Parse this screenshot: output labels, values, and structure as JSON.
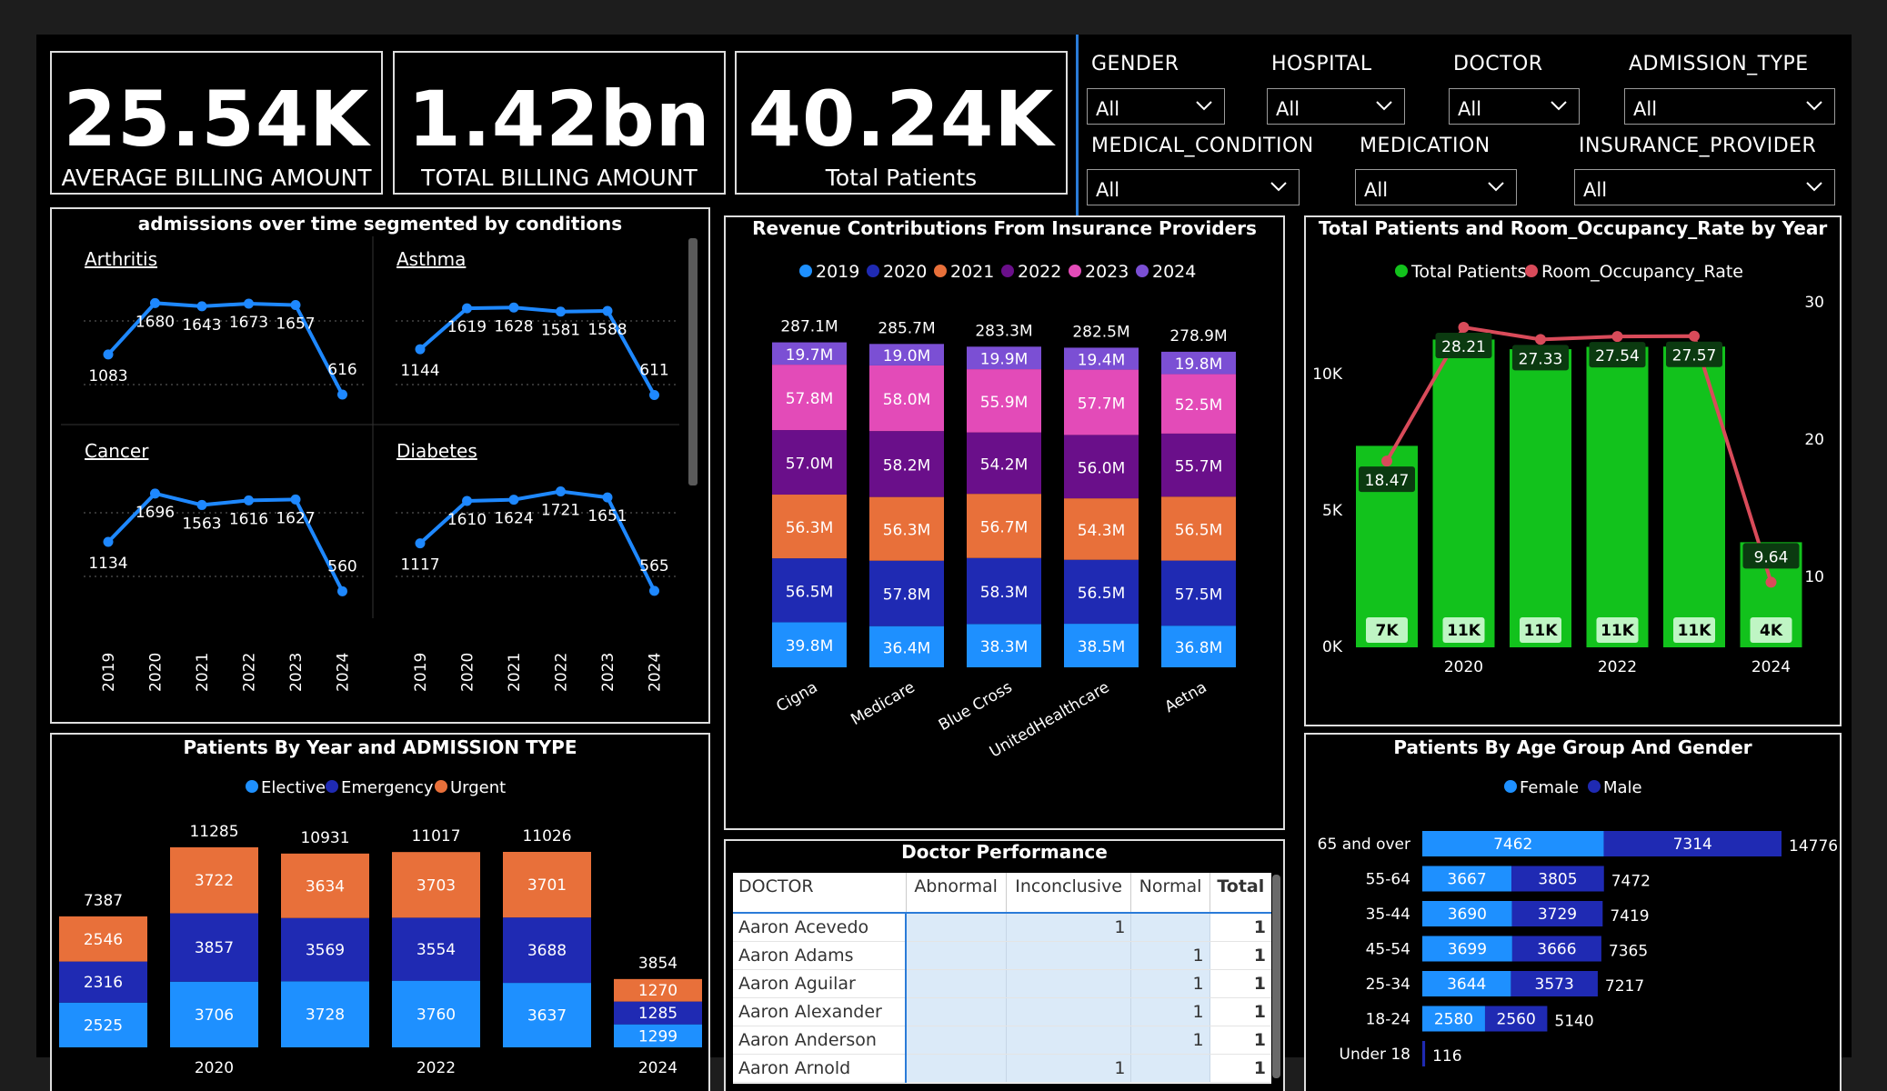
{
  "kpis": [
    {
      "value": "25.54K",
      "label": "AVERAGE BILLING AMOUNT"
    },
    {
      "value": "1.42bn",
      "label": "TOTAL BILLING AMOUNT"
    },
    {
      "value": "40.24K",
      "label": "Total Patients"
    }
  ],
  "slicers": [
    {
      "label": "GENDER",
      "value": "All"
    },
    {
      "label": "HOSPITAL",
      "value": "All"
    },
    {
      "label": "DOCTOR",
      "value": "All"
    },
    {
      "label": "ADMISSION_TYPE",
      "value": "All"
    },
    {
      "label": "MEDICAL_CONDITION",
      "value": "All"
    },
    {
      "label": "MEDICATION",
      "value": "All"
    },
    {
      "label": "INSURANCE_PROVIDER",
      "value": "All"
    }
  ],
  "colors": {
    "blue_line": "#1e88ff",
    "elective": "#1e90ff",
    "emergency": "#1f2ab3",
    "urgent": "#e8703a",
    "green": "#12c21c",
    "red": "#d94b5a",
    "female": "#1e90ff",
    "male": "#1f2ab3"
  },
  "admissions": {
    "title": "admissions over time segmented by conditions",
    "years": [
      "2019",
      "2020",
      "2021",
      "2022",
      "2023",
      "2024"
    ],
    "conditions": [
      {
        "name": "Arthritis",
        "values": [
          1083,
          1680,
          1643,
          1673,
          1657,
          616
        ]
      },
      {
        "name": "Asthma",
        "values": [
          1144,
          1619,
          1628,
          1581,
          1588,
          611
        ]
      },
      {
        "name": "Cancer",
        "values": [
          1134,
          1696,
          1563,
          1616,
          1627,
          560
        ]
      },
      {
        "name": "Diabetes",
        "values": [
          1117,
          1610,
          1624,
          1721,
          1651,
          565
        ]
      }
    ]
  },
  "chart_data": [
    {
      "type": "bar",
      "title": "Revenue Contributions From Insurance Providers",
      "categories": [
        "Cigna",
        "Medicare",
        "Blue Cross",
        "UnitedHealthcare",
        "Aetna"
      ],
      "totals": [
        "287.1M",
        "285.7M",
        "283.3M",
        "282.5M",
        "278.9M"
      ],
      "series": [
        {
          "name": "2019",
          "color": "#1e90ff",
          "values": [
            39.8,
            36.4,
            38.3,
            38.5,
            36.8
          ],
          "labels": [
            "39.8M",
            "36.4M",
            "38.3M",
            "38.5M",
            "36.8M"
          ]
        },
        {
          "name": "2020",
          "color": "#1f2ab3",
          "values": [
            56.5,
            57.8,
            58.3,
            56.5,
            57.5
          ],
          "labels": [
            "56.5M",
            "57.8M",
            "58.3M",
            "56.5M",
            "57.5M"
          ]
        },
        {
          "name": "2021",
          "color": "#e8703a",
          "values": [
            56.3,
            56.3,
            56.7,
            54.3,
            56.5
          ],
          "labels": [
            "56.3M",
            "56.3M",
            "56.7M",
            "54.3M",
            "56.5M"
          ]
        },
        {
          "name": "2022",
          "color": "#6a0f8a",
          "values": [
            57.0,
            58.2,
            54.2,
            56.0,
            55.7
          ],
          "labels": [
            "57.0M",
            "58.2M",
            "54.2M",
            "56.0M",
            "55.7M"
          ]
        },
        {
          "name": "2023",
          "color": "#e34bb8",
          "values": [
            57.8,
            58.0,
            55.9,
            57.7,
            52.5
          ],
          "labels": [
            "57.8M",
            "58.0M",
            "55.9M",
            "57.7M",
            "52.5M"
          ]
        },
        {
          "name": "2024",
          "color": "#7b4fd4",
          "values": [
            19.7,
            19.0,
            19.9,
            19.4,
            19.8
          ],
          "labels": [
            "19.7M",
            "19.0M",
            "19.9M",
            "19.4M",
            "19.8M"
          ]
        }
      ]
    },
    {
      "type": "bar",
      "title": "Total Patients and Room_Occupancy_Rate by Year",
      "categories": [
        "2019",
        "2020",
        "2021",
        "2022",
        "2023",
        "2024"
      ],
      "x_tick_labels": [
        "2020",
        "2022",
        "2024"
      ],
      "left_axis_ticks": [
        "0K",
        "5K",
        "10K"
      ],
      "right_axis_ticks": [
        "10",
        "20",
        "30"
      ],
      "series": [
        {
          "name": "Total Patients",
          "type": "bar",
          "values": [
            7387,
            11285,
            10931,
            11017,
            11026,
            3854
          ],
          "labels": [
            "7K",
            "11K",
            "11K",
            "11K",
            "11K",
            "4K"
          ]
        },
        {
          "name": "Room_Occupancy_Rate",
          "type": "line",
          "values": [
            18.47,
            28.21,
            27.33,
            27.54,
            27.57,
            9.64
          ]
        }
      ]
    },
    {
      "type": "bar",
      "title": "Patients By Year and ADMISSION TYPE",
      "categories": [
        "2019",
        "2020",
        "2021",
        "2022",
        "2023",
        "2024"
      ],
      "x_tick_labels": [
        "2020",
        "2022",
        "2024"
      ],
      "totals": [
        7387,
        11285,
        10931,
        11017,
        11026,
        3854
      ],
      "series": [
        {
          "name": "Elective",
          "values": [
            2525,
            3706,
            3728,
            3760,
            3637,
            1299
          ]
        },
        {
          "name": "Emergency",
          "values": [
            2316,
            3857,
            3569,
            3554,
            3688,
            1285
          ]
        },
        {
          "name": "Urgent",
          "values": [
            2546,
            3722,
            3634,
            3703,
            3701,
            1270
          ]
        }
      ]
    },
    {
      "type": "bar",
      "title": "Patients By Age Group And Gender",
      "categories": [
        "65 and over",
        "55-64",
        "35-44",
        "45-54",
        "25-34",
        "18-24",
        "Under 18"
      ],
      "totals": [
        14776,
        7472,
        7419,
        7365,
        7217,
        5140,
        116
      ],
      "series": [
        {
          "name": "Female",
          "values": [
            7462,
            3667,
            3690,
            3699,
            3644,
            2580,
            null
          ]
        },
        {
          "name": "Male",
          "values": [
            7314,
            3805,
            3729,
            3666,
            3573,
            2560,
            null
          ]
        }
      ]
    }
  ],
  "doctor_performance": {
    "title": "Doctor Performance",
    "columns": [
      "DOCTOR",
      "Abnormal",
      "Inconclusive",
      "Normal",
      "Total"
    ],
    "rows": [
      [
        "Aaron Acevedo",
        "",
        "1",
        "",
        "1"
      ],
      [
        "Aaron Adams",
        "",
        "",
        "1",
        "1"
      ],
      [
        "Aaron Aguilar",
        "",
        "",
        "1",
        "1"
      ],
      [
        "Aaron Alexander",
        "",
        "",
        "1",
        "1"
      ],
      [
        "Aaron Anderson",
        "",
        "",
        "1",
        "1"
      ],
      [
        "Aaron Arnold",
        "",
        "1",
        "",
        "1"
      ]
    ]
  }
}
